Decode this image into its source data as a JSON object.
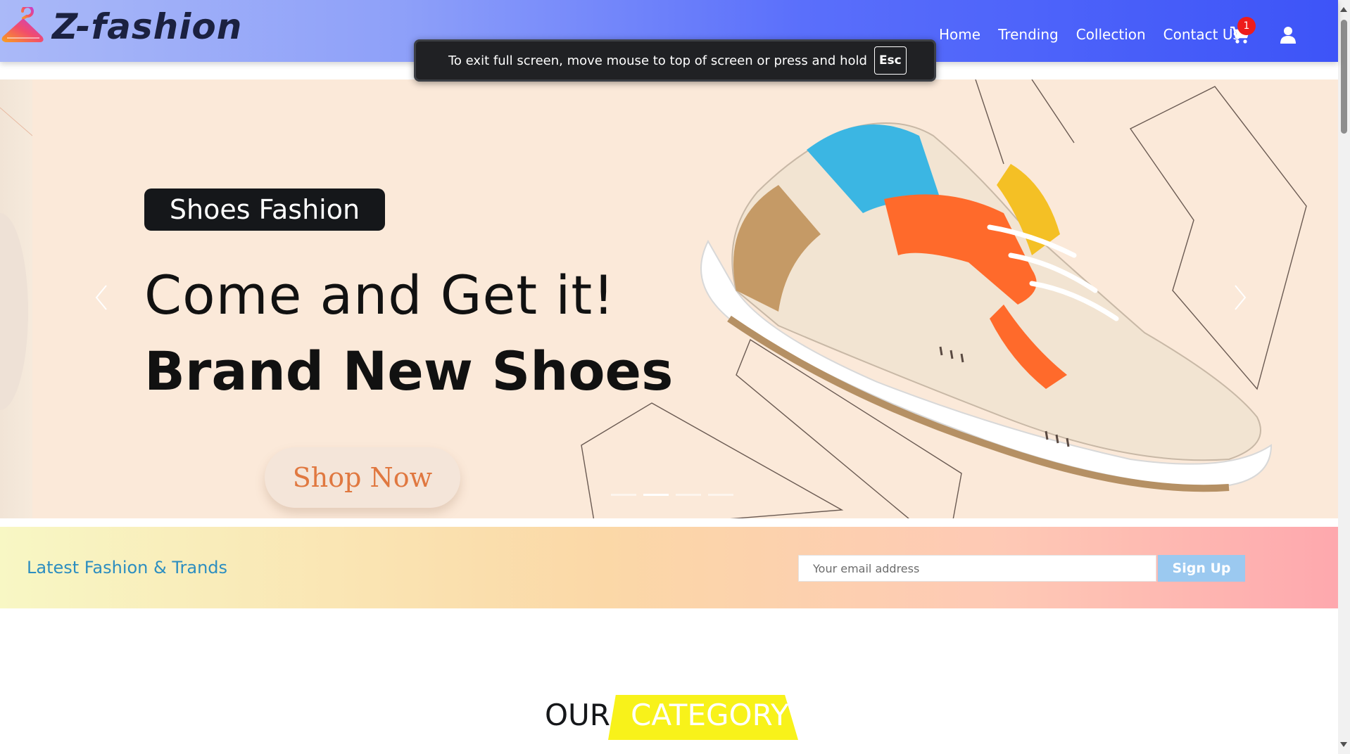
{
  "brand": {
    "name": "Z-fashion",
    "logo_icon": "hanger-icon"
  },
  "nav": {
    "links": [
      "Home",
      "Trending",
      "Collection",
      "Contact Us"
    ],
    "cart_count": "1",
    "cart_icon": "cart-icon",
    "user_icon": "user-icon"
  },
  "fullscreen_toast": {
    "message": "To exit full screen, move mouse to top of screen or press and hold",
    "key": "Esc"
  },
  "hero": {
    "tag": "Shoes Fashion",
    "headline1": "Come and Get it!",
    "headline2": "Brand New Shoes",
    "cta": "Shop Now",
    "slide_count": 4,
    "active_slide": 2
  },
  "newsletter": {
    "title": "Latest Fashion & Trands",
    "placeholder": "Your email address",
    "button": "Sign Up"
  },
  "category": {
    "prefix": "OUR",
    "highlight": "CATEGORY"
  },
  "colors": {
    "nav_start": "#aab9f8",
    "nav_end": "#3d54f8",
    "accent_yellow": "#f8f21a",
    "newsletter_title": "#2d8ec0",
    "badge": "#ee1c1c"
  }
}
